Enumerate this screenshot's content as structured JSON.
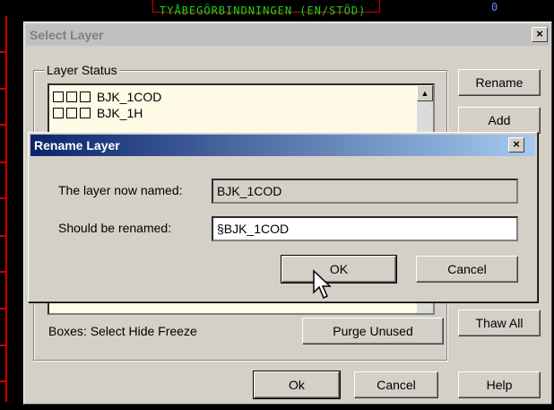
{
  "background": {
    "cad_text": "TYÅBEGÖRBINDNINGEN (EN/STÖD)",
    "cad_number": "0"
  },
  "select_layer": {
    "title": "Select Layer",
    "close_label": "×",
    "group_label": "Layer Status",
    "layers": [
      {
        "name": "BJK_1COD"
      },
      {
        "name": "BJK_1H"
      }
    ],
    "scroll_up_glyph": "▲",
    "boxes_label": "Boxes: Select Hide Freeze",
    "buttons": {
      "rename": "Rename",
      "add": "Add",
      "thaw_all": "Thaw All",
      "purge_unused": "Purge Unused",
      "ok": "Ok",
      "cancel": "Cancel",
      "help": "Help"
    }
  },
  "rename_layer": {
    "title": "Rename Layer",
    "close_label": "×",
    "now_named_label": "The layer now named:",
    "now_named_value": "BJK_1COD",
    "rename_label": "Should be renamed:",
    "rename_value": "§BJK_1COD",
    "ok_label": "OK",
    "cancel_label": "Cancel"
  },
  "colors": {
    "cad_red": "#cc0000",
    "cad_green": "#19d219",
    "title_active": "#0a246a",
    "dialog_face": "#d4d0c8"
  }
}
